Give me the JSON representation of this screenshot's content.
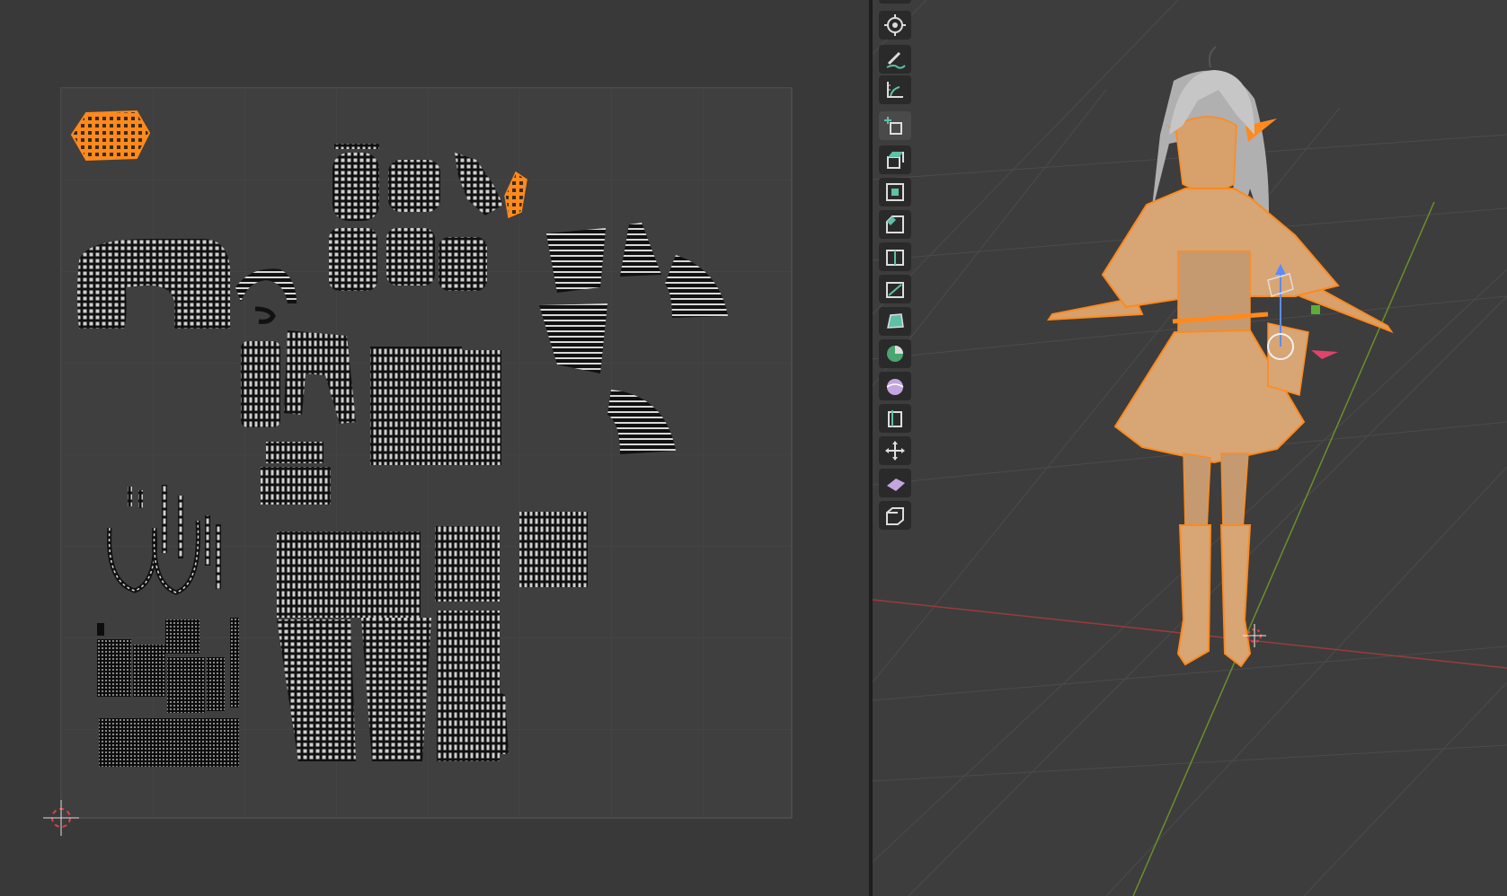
{
  "uv_editor": {
    "selected_island": "head-cap",
    "colors": {
      "background": "#393939",
      "uv_bounds_fill": "#3f3f3f",
      "grid": "#474747",
      "island_wire": "#111111",
      "island_fill": "#cfcfcf",
      "selection": "#ff8a1c"
    }
  },
  "viewport": {
    "colors": {
      "background": "#3d3d3d",
      "grid": "#4a4a4a",
      "x_axis": "#9a3b3b",
      "y_axis": "#6a8f2a",
      "selection": "#ff8a1c",
      "hair": "#b5b5b5"
    },
    "object": "anime-girl-character"
  },
  "toolbar": {
    "tools": [
      {
        "icon": "cursor-icon"
      },
      {
        "icon": "annotate-icon"
      },
      {
        "icon": "measure-icon"
      },
      {
        "icon": "add-cube-icon"
      },
      {
        "icon": "extrude-region-icon"
      },
      {
        "icon": "inset-faces-icon"
      },
      {
        "icon": "bevel-icon"
      },
      {
        "icon": "loop-cut-icon"
      },
      {
        "icon": "knife-icon"
      },
      {
        "icon": "poly-build-icon"
      },
      {
        "icon": "spin-icon"
      },
      {
        "icon": "smooth-icon"
      },
      {
        "icon": "edge-slide-icon"
      },
      {
        "icon": "shrink-fatten-icon"
      },
      {
        "icon": "shear-icon"
      },
      {
        "icon": "rip-region-icon"
      }
    ]
  }
}
